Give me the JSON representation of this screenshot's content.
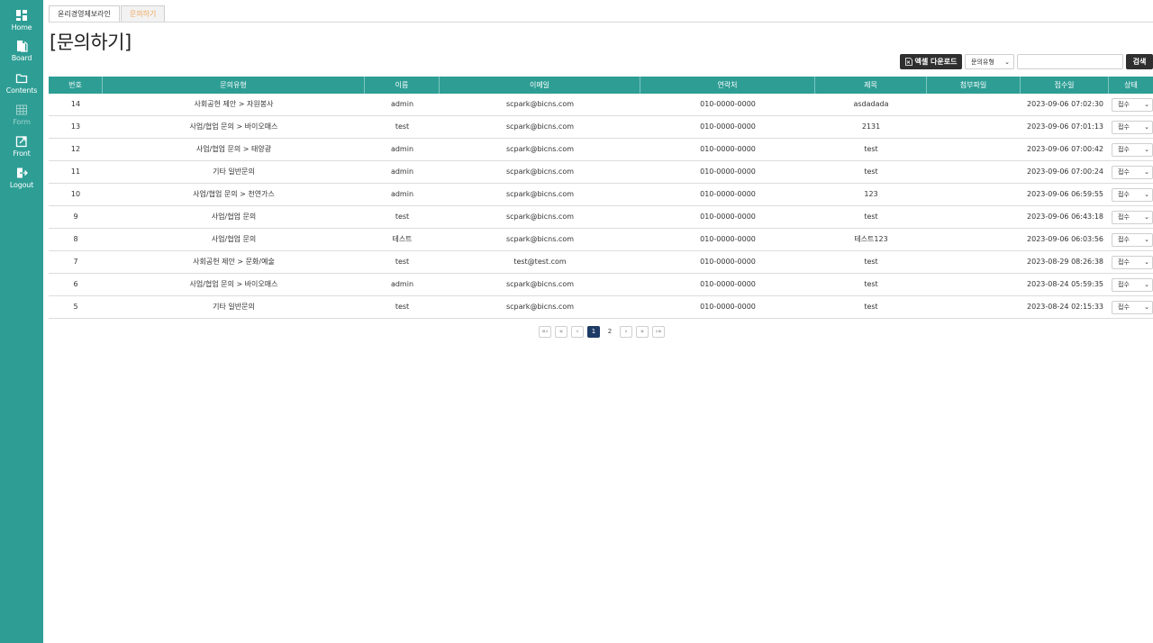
{
  "sidebar": {
    "items": [
      {
        "label": "Home",
        "icon": "dashboard-icon"
      },
      {
        "label": "Board",
        "icon": "documents-icon"
      },
      {
        "label": "Contents",
        "icon": "folder-icon"
      },
      {
        "label": "Form",
        "icon": "table-icon"
      },
      {
        "label": "Front",
        "icon": "external-link-icon"
      },
      {
        "label": "Logout",
        "icon": "logout-icon"
      }
    ]
  },
  "tabs": [
    {
      "label": "윤리경영제보라인"
    },
    {
      "label": "문의하기"
    }
  ],
  "page": {
    "title": "[문의하기]"
  },
  "toolbar": {
    "excel_label": "엑셀 다운로드",
    "type_select": "문의유형",
    "search_value": "",
    "search_label": "검색"
  },
  "table": {
    "headers": [
      "번호",
      "문의유형",
      "이름",
      "이메일",
      "연락처",
      "제목",
      "첨부파일",
      "접수일",
      "상태"
    ],
    "rows": [
      {
        "no": "14",
        "type": "사회공헌 제안 > 자원봉사",
        "name": "admin",
        "email": "scpark@bicns.com",
        "phone": "010-0000-0000",
        "title": "asdadada",
        "file": "",
        "date": "2023-09-06 07:02:30",
        "status": "접수"
      },
      {
        "no": "13",
        "type": "사업/협업 문의 > 바이오매스",
        "name": "test",
        "email": "scpark@bicns.com",
        "phone": "010-0000-0000",
        "title": "2131",
        "file": "",
        "date": "2023-09-06 07:01:13",
        "status": "접수"
      },
      {
        "no": "12",
        "type": "사업/협업 문의 > 태양광",
        "name": "admin",
        "email": "scpark@bicns.com",
        "phone": "010-0000-0000",
        "title": "test",
        "file": "",
        "date": "2023-09-06 07:00:42",
        "status": "접수"
      },
      {
        "no": "11",
        "type": "기타 일반문의",
        "name": "admin",
        "email": "scpark@bicns.com",
        "phone": "010-0000-0000",
        "title": "test",
        "file": "",
        "date": "2023-09-06 07:00:24",
        "status": "접수"
      },
      {
        "no": "10",
        "type": "사업/협업 문의 > 천연가스",
        "name": "admin",
        "email": "scpark@bicns.com",
        "phone": "010-0000-0000",
        "title": "123",
        "file": "",
        "date": "2023-09-06 06:59:55",
        "status": "접수"
      },
      {
        "no": "9",
        "type": "사업/협업 문의",
        "name": "test",
        "email": "scpark@bicns.com",
        "phone": "010-0000-0000",
        "title": "test",
        "file": "",
        "date": "2023-09-06 06:43:18",
        "status": "접수"
      },
      {
        "no": "8",
        "type": "사업/협업 문의",
        "name": "테스트",
        "email": "scpark@bicns.com",
        "phone": "010-0000-0000",
        "title": "테스트123",
        "file": "",
        "date": "2023-09-06 06:03:56",
        "status": "접수"
      },
      {
        "no": "7",
        "type": "사회공헌 제안 > 문화/예술",
        "name": "test",
        "email": "test@test.com",
        "phone": "010-0000-0000",
        "title": "test",
        "file": "",
        "date": "2023-08-29 08:26:38",
        "status": "접수"
      },
      {
        "no": "6",
        "type": "사업/협업 문의 > 바이오매스",
        "name": "admin",
        "email": "scpark@bicns.com",
        "phone": "010-0000-0000",
        "title": "test",
        "file": "",
        "date": "2023-08-24 05:59:35",
        "status": "접수"
      },
      {
        "no": "5",
        "type": "기타 일반문의",
        "name": "test",
        "email": "scpark@bicns.com",
        "phone": "010-0000-0000",
        "title": "test",
        "file": "",
        "date": "2023-08-24 02:15:33",
        "status": "접수"
      }
    ]
  },
  "pagination": {
    "first": "«‹",
    "prev_group": "«",
    "prev": "‹",
    "pages": [
      "1",
      "2"
    ],
    "current": "1",
    "next": "›",
    "next_group": "»",
    "last": "›»"
  },
  "colors": {
    "accent": "#2e9e95",
    "active_tab": "#f0a85c",
    "current_page": "#1d3b66",
    "dark_button": "#2f2f2f"
  }
}
